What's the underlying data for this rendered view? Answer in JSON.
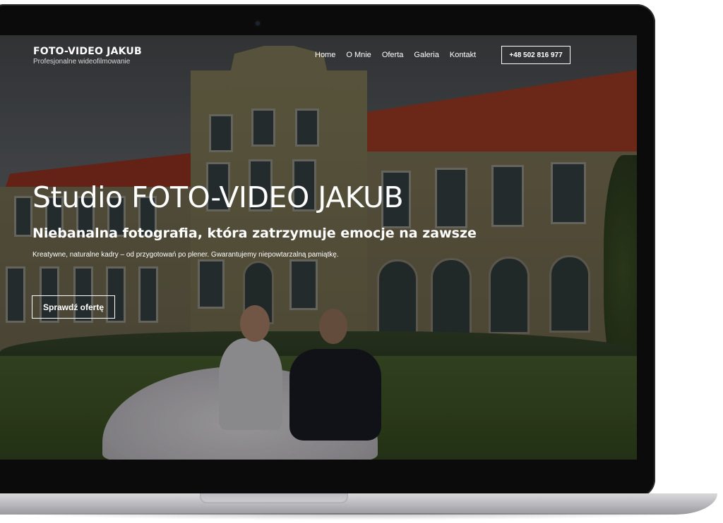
{
  "site": {
    "brand_name": "FOTO-VIDEO JAKUB",
    "brand_tagline": "Profesjonalne wideofilmowanie"
  },
  "nav": {
    "items": [
      {
        "label": "Home"
      },
      {
        "label": "O Mnie"
      },
      {
        "label": "Oferta"
      },
      {
        "label": "Galeria"
      },
      {
        "label": "Kontakt"
      }
    ],
    "phone_label": "+48 502 816 977"
  },
  "hero": {
    "title": "Studio FOTO-VIDEO JAKUB",
    "subtitle": "Niebanalna fotografia, która zatrzymuje emocje na zawsze",
    "description": "Kreatywne, naturalne kadry – od przygotowań po plener. Gwarantujemy niepowtarzalną pamiątkę.",
    "cta_label": "Sprawdź ofertę"
  }
}
